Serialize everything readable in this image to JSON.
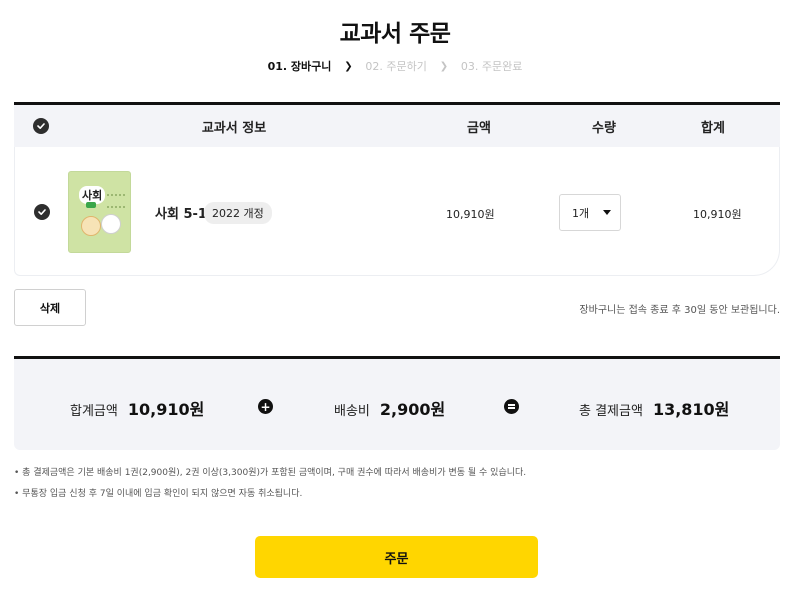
{
  "page": {
    "title": "교과서 주문"
  },
  "steps": [
    {
      "label": "01. 장바구니",
      "active": true
    },
    {
      "label": "02. 주문하기",
      "active": false
    },
    {
      "label": "03. 주문완료",
      "active": false
    }
  ],
  "cart": {
    "headers": {
      "info": "교과서 정보",
      "price": "금액",
      "qty": "수량",
      "total": "합계"
    },
    "items": [
      {
        "checked": true,
        "book_cover_text": "사회",
        "name": "사회 5-1",
        "badge": "2022 개정",
        "price": "10,910원",
        "qty": "1개",
        "total": "10,910원"
      }
    ]
  },
  "actions": {
    "delete_label": "삭제",
    "keep_note": "장바구니는 접속 종료 후 30일 동안 보관됩니다."
  },
  "summary": {
    "subtotal_label": "합계금액",
    "subtotal_value": "10,910원",
    "shipping_label": "배송비",
    "shipping_value": "2,900원",
    "grand_label": "총 결제금액",
    "grand_value": "13,810원"
  },
  "notes": [
    "총 결제금액은 기본 배송비 1권(2,900원), 2권 이상(3,300원)가 포함된 금액이며, 구매 권수에 따라서 배송비가 변동 될 수 있습니다.",
    "무통장 입금 신청 후 7일 이내에 입금 확인이 되지 않으면 자동 취소됩니다."
  ],
  "order_button": "주문",
  "colors": {
    "accent": "#ffd600",
    "header_bg": "#f3f4f8",
    "text": "#111111"
  }
}
